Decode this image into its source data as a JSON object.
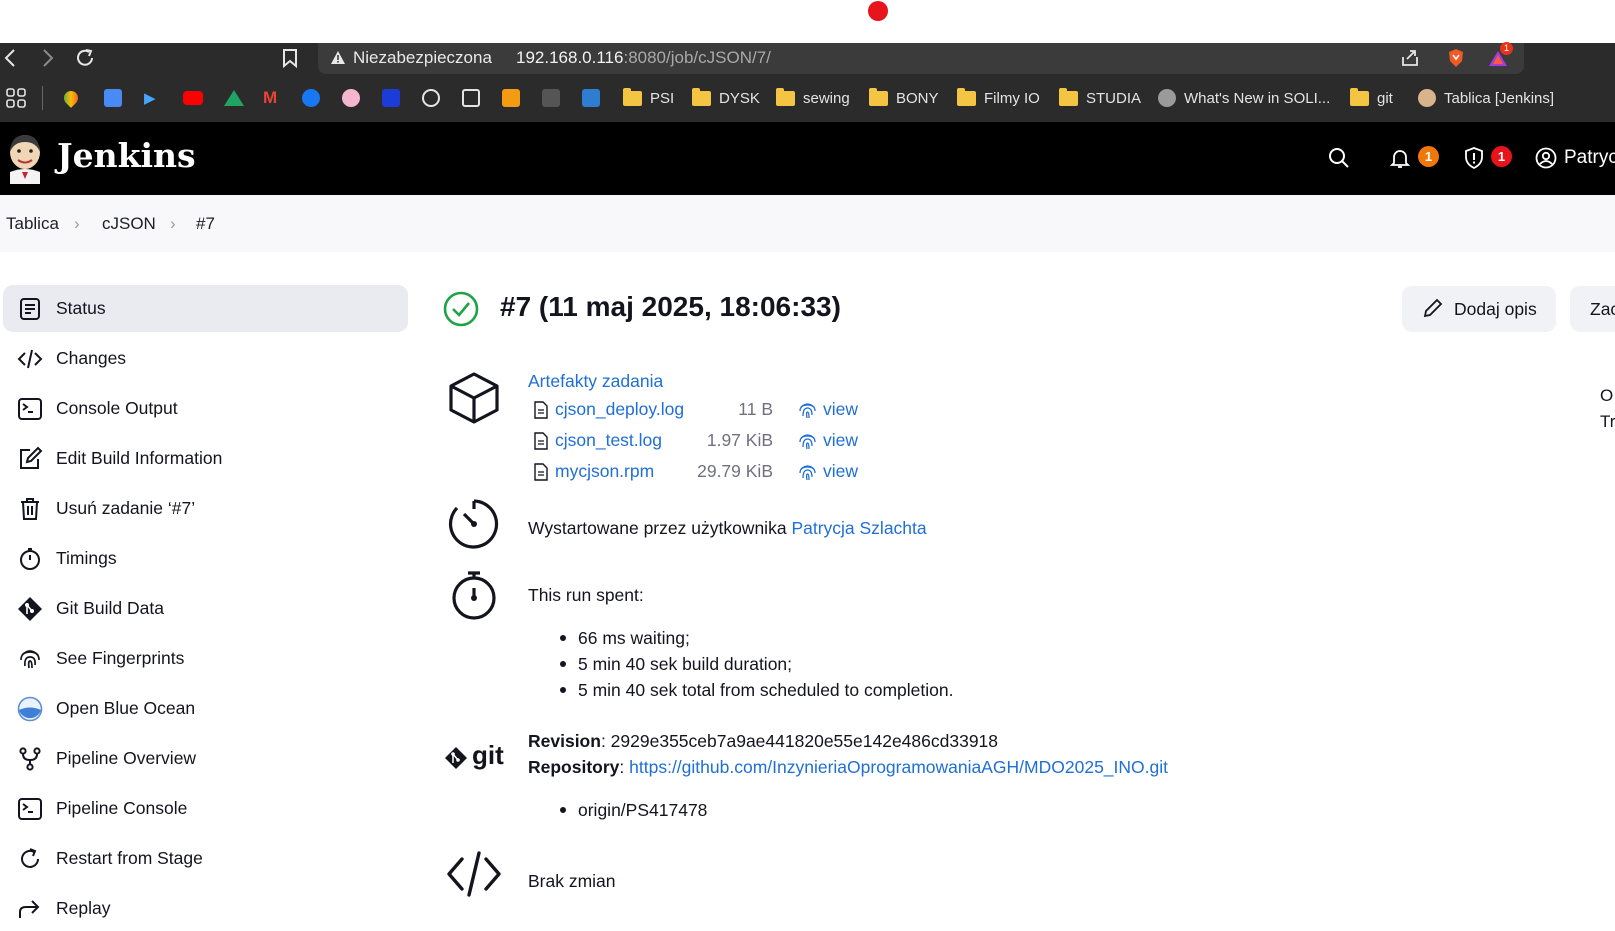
{
  "browser": {
    "security_label": "Niezabezpieczona",
    "url_host": "192.168.0.116",
    "url_rest": ":8080/job/cJSON/7/",
    "extension_badge": "1"
  },
  "bookmarks": [
    {
      "type": "folder",
      "label": "PSI"
    },
    {
      "type": "folder",
      "label": "DYSK"
    },
    {
      "type": "folder",
      "label": "sewing"
    },
    {
      "type": "folder",
      "label": "BONY"
    },
    {
      "type": "folder",
      "label": "Filmy IO"
    },
    {
      "type": "folder",
      "label": "STUDIA"
    },
    {
      "type": "site",
      "label": "What's New in SOLI..."
    },
    {
      "type": "folder",
      "label": "git"
    },
    {
      "type": "site",
      "label": "Tablica [Jenkins]"
    }
  ],
  "header": {
    "title": "Jenkins",
    "notifications_count": "1",
    "security_count": "1",
    "user": "Patryc"
  },
  "breadcrumb": [
    "Tablica",
    "cJSON",
    "#7"
  ],
  "sidebar": {
    "items": [
      {
        "label": "Status",
        "icon": "status-icon"
      },
      {
        "label": "Changes",
        "icon": "code-icon"
      },
      {
        "label": "Console Output",
        "icon": "terminal-icon"
      },
      {
        "label": "Edit Build Information",
        "icon": "edit-icon"
      },
      {
        "label": "Usuń zadanie ‘#7’",
        "icon": "trash-icon"
      },
      {
        "label": "Timings",
        "icon": "stopwatch-icon"
      },
      {
        "label": "Git Build Data",
        "icon": "git-icon"
      },
      {
        "label": "See Fingerprints",
        "icon": "fingerprint-icon"
      },
      {
        "label": "Open Blue Ocean",
        "icon": "blue-ocean-icon"
      },
      {
        "label": "Pipeline Overview",
        "icon": "pipeline-icon"
      },
      {
        "label": "Pipeline Console",
        "icon": "terminal-icon"
      },
      {
        "label": "Restart from Stage",
        "icon": "restart-icon"
      },
      {
        "label": "Replay",
        "icon": "replay-icon"
      }
    ]
  },
  "build": {
    "title": "#7 (11 maj 2025, 18:06:33)",
    "add_description": "Dodaj opis",
    "keep_button_partial": "Zac",
    "edge_text_1": "O",
    "edge_text_2": "Tr"
  },
  "artifacts": {
    "title": "Artefakty zadania",
    "files": [
      {
        "name": "cjson_deploy.log",
        "size": "11 B",
        "view": "view"
      },
      {
        "name": "cjson_test.log",
        "size": "1.97 KiB",
        "view": "view"
      },
      {
        "name": "mycjson.rpm",
        "size": "29.79 KiB",
        "view": "view"
      }
    ]
  },
  "started_by": {
    "prefix": "Wystartowane przez użytkownika",
    "user": "Patrycja Szlachta"
  },
  "timing": {
    "heading": "This run spent:",
    "items": [
      "66 ms waiting;",
      "5 min 40 sek build duration;",
      "5 min 40 sek total from scheduled to completion."
    ]
  },
  "git": {
    "logo_text": "git",
    "revision_label": "Revision",
    "revision": ": 2929e355ceb7a9ae441820e55e142e486cd33918",
    "repository_label": "Repository",
    "repository_sep": ": ",
    "repository_url": "https://github.com/InzynieriaOprogramowaniaAGH/MDO2025_INO.git",
    "branch": "origin/PS417478"
  },
  "changes": {
    "text": "Brak zmian"
  }
}
